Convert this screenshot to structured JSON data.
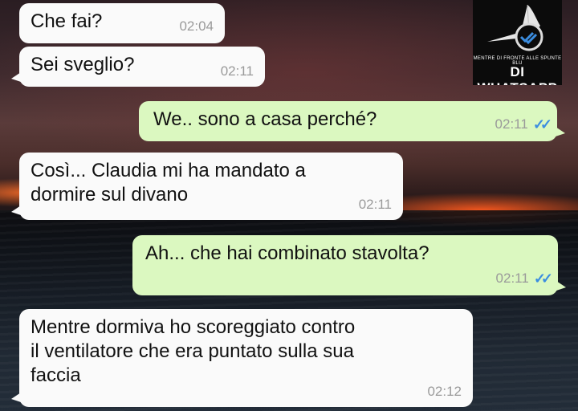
{
  "messages": [
    {
      "text": "Che fai?",
      "time": "02:04",
      "direction": "in"
    },
    {
      "text": "Sei sveglio?",
      "time": "02:11",
      "direction": "in"
    },
    {
      "text": "We.. sono a casa perché?",
      "time": "02:11",
      "direction": "out",
      "status": "read-double-check"
    },
    {
      "text": "Così... Claudia mi ha mandato a\ndormire sul divano",
      "time": "02:11",
      "direction": "in"
    },
    {
      "text": "Ah... che hai combinato stavolta?",
      "time": "02:11",
      "direction": "out",
      "status": "read-double-check"
    },
    {
      "text": "Mentre dormiva ho scoreggiato contro\nil ventilatore che era puntato sulla sua\nfaccia",
      "time": "02:12",
      "direction": "in"
    }
  ],
  "watermark": {
    "small_text": "MENTRE DI FRONTE ALLE SPUNTE BLU",
    "big_text": "DI WHATSAPP",
    "icon": "double-check-flag-icon"
  },
  "colors": {
    "incoming_bubble": "#fafafa",
    "outgoing_bubble": "#dbf8c0",
    "read_ticks": "#3b8de0",
    "timestamp": "#9a9a9a"
  }
}
